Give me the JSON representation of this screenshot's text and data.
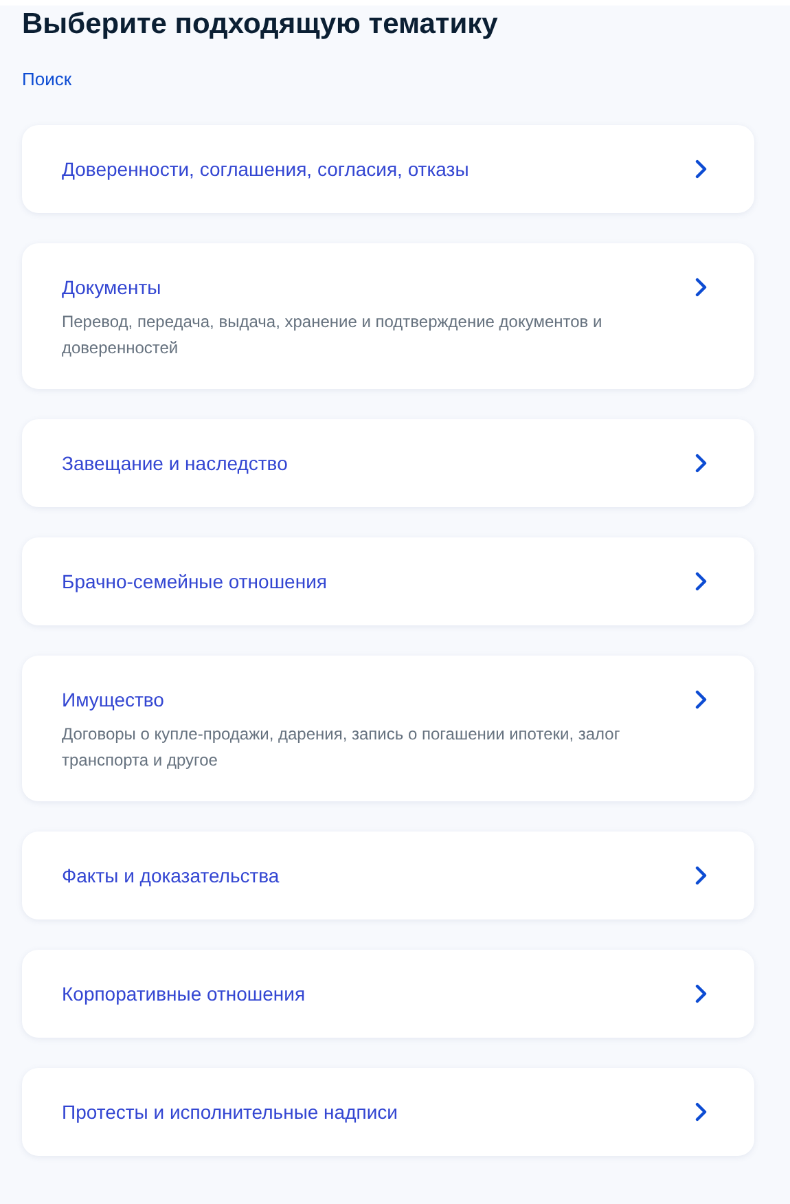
{
  "title": "Выберите подходящую тематику",
  "search_link": "Поиск",
  "topics": [
    {
      "title": "Доверенности, соглашения, согласия, отказы"
    },
    {
      "title": "Документы",
      "description": "Перевод, передача, выдача, хранение и подтверждение документов и доверенностей"
    },
    {
      "title": "Завещание и наследство"
    },
    {
      "title": "Брачно-семейные отношения"
    },
    {
      "title": "Имущество",
      "description": "Договоры о купле-продажи, дарения, запись о погашении ипотеки, залог транспорта и другое"
    },
    {
      "title": "Факты и доказательства"
    },
    {
      "title": "Корпоративные отношения"
    },
    {
      "title": "Протесты и исполнительные надписи"
    }
  ]
}
